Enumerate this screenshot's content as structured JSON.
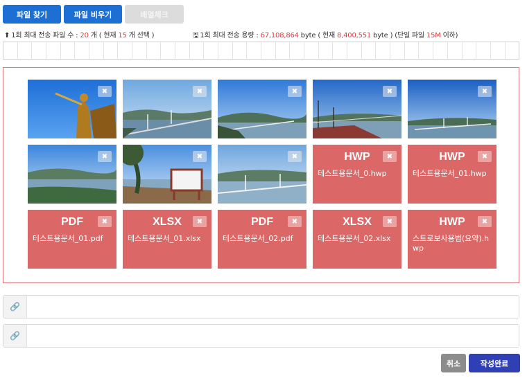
{
  "toolbar": {
    "find_label": "파일 찾기",
    "clear_label": "파일 비우기",
    "order_label": "배열체크"
  },
  "info": {
    "count_prefix": "1회 최대 전송 파일 수 : ",
    "count_max": "20",
    "count_mid": " 개 ( 현재 ",
    "count_current": "15",
    "count_suffix": " 개 선택 )",
    "size_prefix": "1회 최대 전송 용량 : ",
    "size_max": "67,108,864",
    "size_mid": " byte ( 현재 ",
    "size_current": "8,400,551",
    "size_mid2": " byte ) (단일 파일 ",
    "size_single": "15M",
    "size_suffix": " 이하)",
    "upload_icon": "upload-icon",
    "disk_icon": "floppy-disk-icon"
  },
  "close_glyph": "✖",
  "files": [
    {
      "kind": "image",
      "scene": "statue"
    },
    {
      "kind": "image",
      "scene": "bridge-aerial"
    },
    {
      "kind": "image",
      "scene": "bridge-islands"
    },
    {
      "kind": "image",
      "scene": "observatory"
    },
    {
      "kind": "image",
      "scene": "bridge-far"
    },
    {
      "kind": "image",
      "scene": "coastline"
    },
    {
      "kind": "image",
      "scene": "signboard"
    },
    {
      "kind": "image",
      "scene": "bridge-dusk"
    },
    {
      "kind": "doc",
      "ext": "HWP",
      "name": "테스트용문서_0.hwp"
    },
    {
      "kind": "doc",
      "ext": "HWP",
      "name": "테스트용문서_01.hwp"
    },
    {
      "kind": "doc",
      "ext": "PDF",
      "name": "테스트용문서_01.pdf"
    },
    {
      "kind": "doc",
      "ext": "XLSX",
      "name": "테스트용문서_01.xlsx"
    },
    {
      "kind": "doc",
      "ext": "PDF",
      "name": "테스트용문서_02.pdf"
    },
    {
      "kind": "doc",
      "ext": "XLSX",
      "name": "테스트용문서_02.xlsx"
    },
    {
      "kind": "doc",
      "ext": "HWP",
      "name": "스트로보사용법(요약).hwp"
    }
  ],
  "url_rows": [
    {
      "value": "",
      "icon": "link-icon"
    },
    {
      "value": "",
      "icon": "link-icon"
    }
  ],
  "actions": {
    "cancel_label": "취소",
    "done_label": "작성완료"
  },
  "colors": {
    "primary": "#1d6fd3",
    "doc_tile": "#dc6767",
    "highlight": "#e03a3a",
    "submit": "#2f40b4"
  }
}
